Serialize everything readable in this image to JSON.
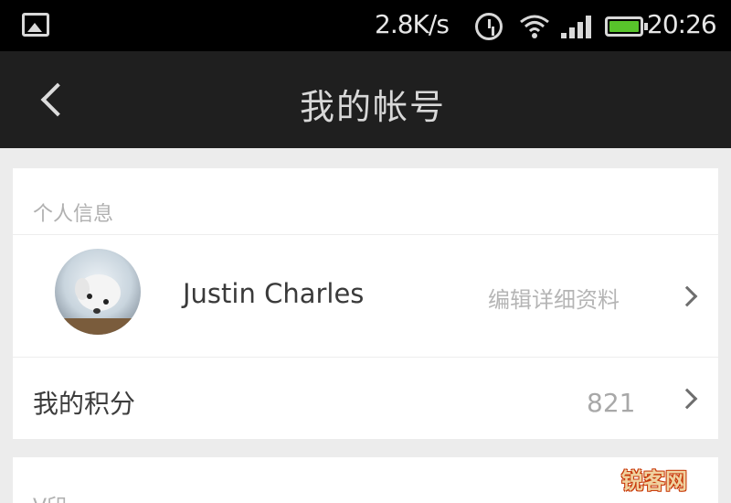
{
  "status_bar": {
    "net_speed": "2.8K/s",
    "time": "20:26",
    "battery_color": "#58c42b"
  },
  "nav_bar": {
    "title": "我的帐号",
    "back_icon": "chevron-left-icon"
  },
  "personal_info": {
    "section_title": "个人信息",
    "profile": {
      "name": "Justin Charles",
      "edit_label": "编辑详细资料"
    },
    "points": {
      "label": "我的积分",
      "value": "821"
    }
  },
  "second_section": {
    "section_title": "V印"
  },
  "watermark": {
    "text": "锐客网"
  }
}
